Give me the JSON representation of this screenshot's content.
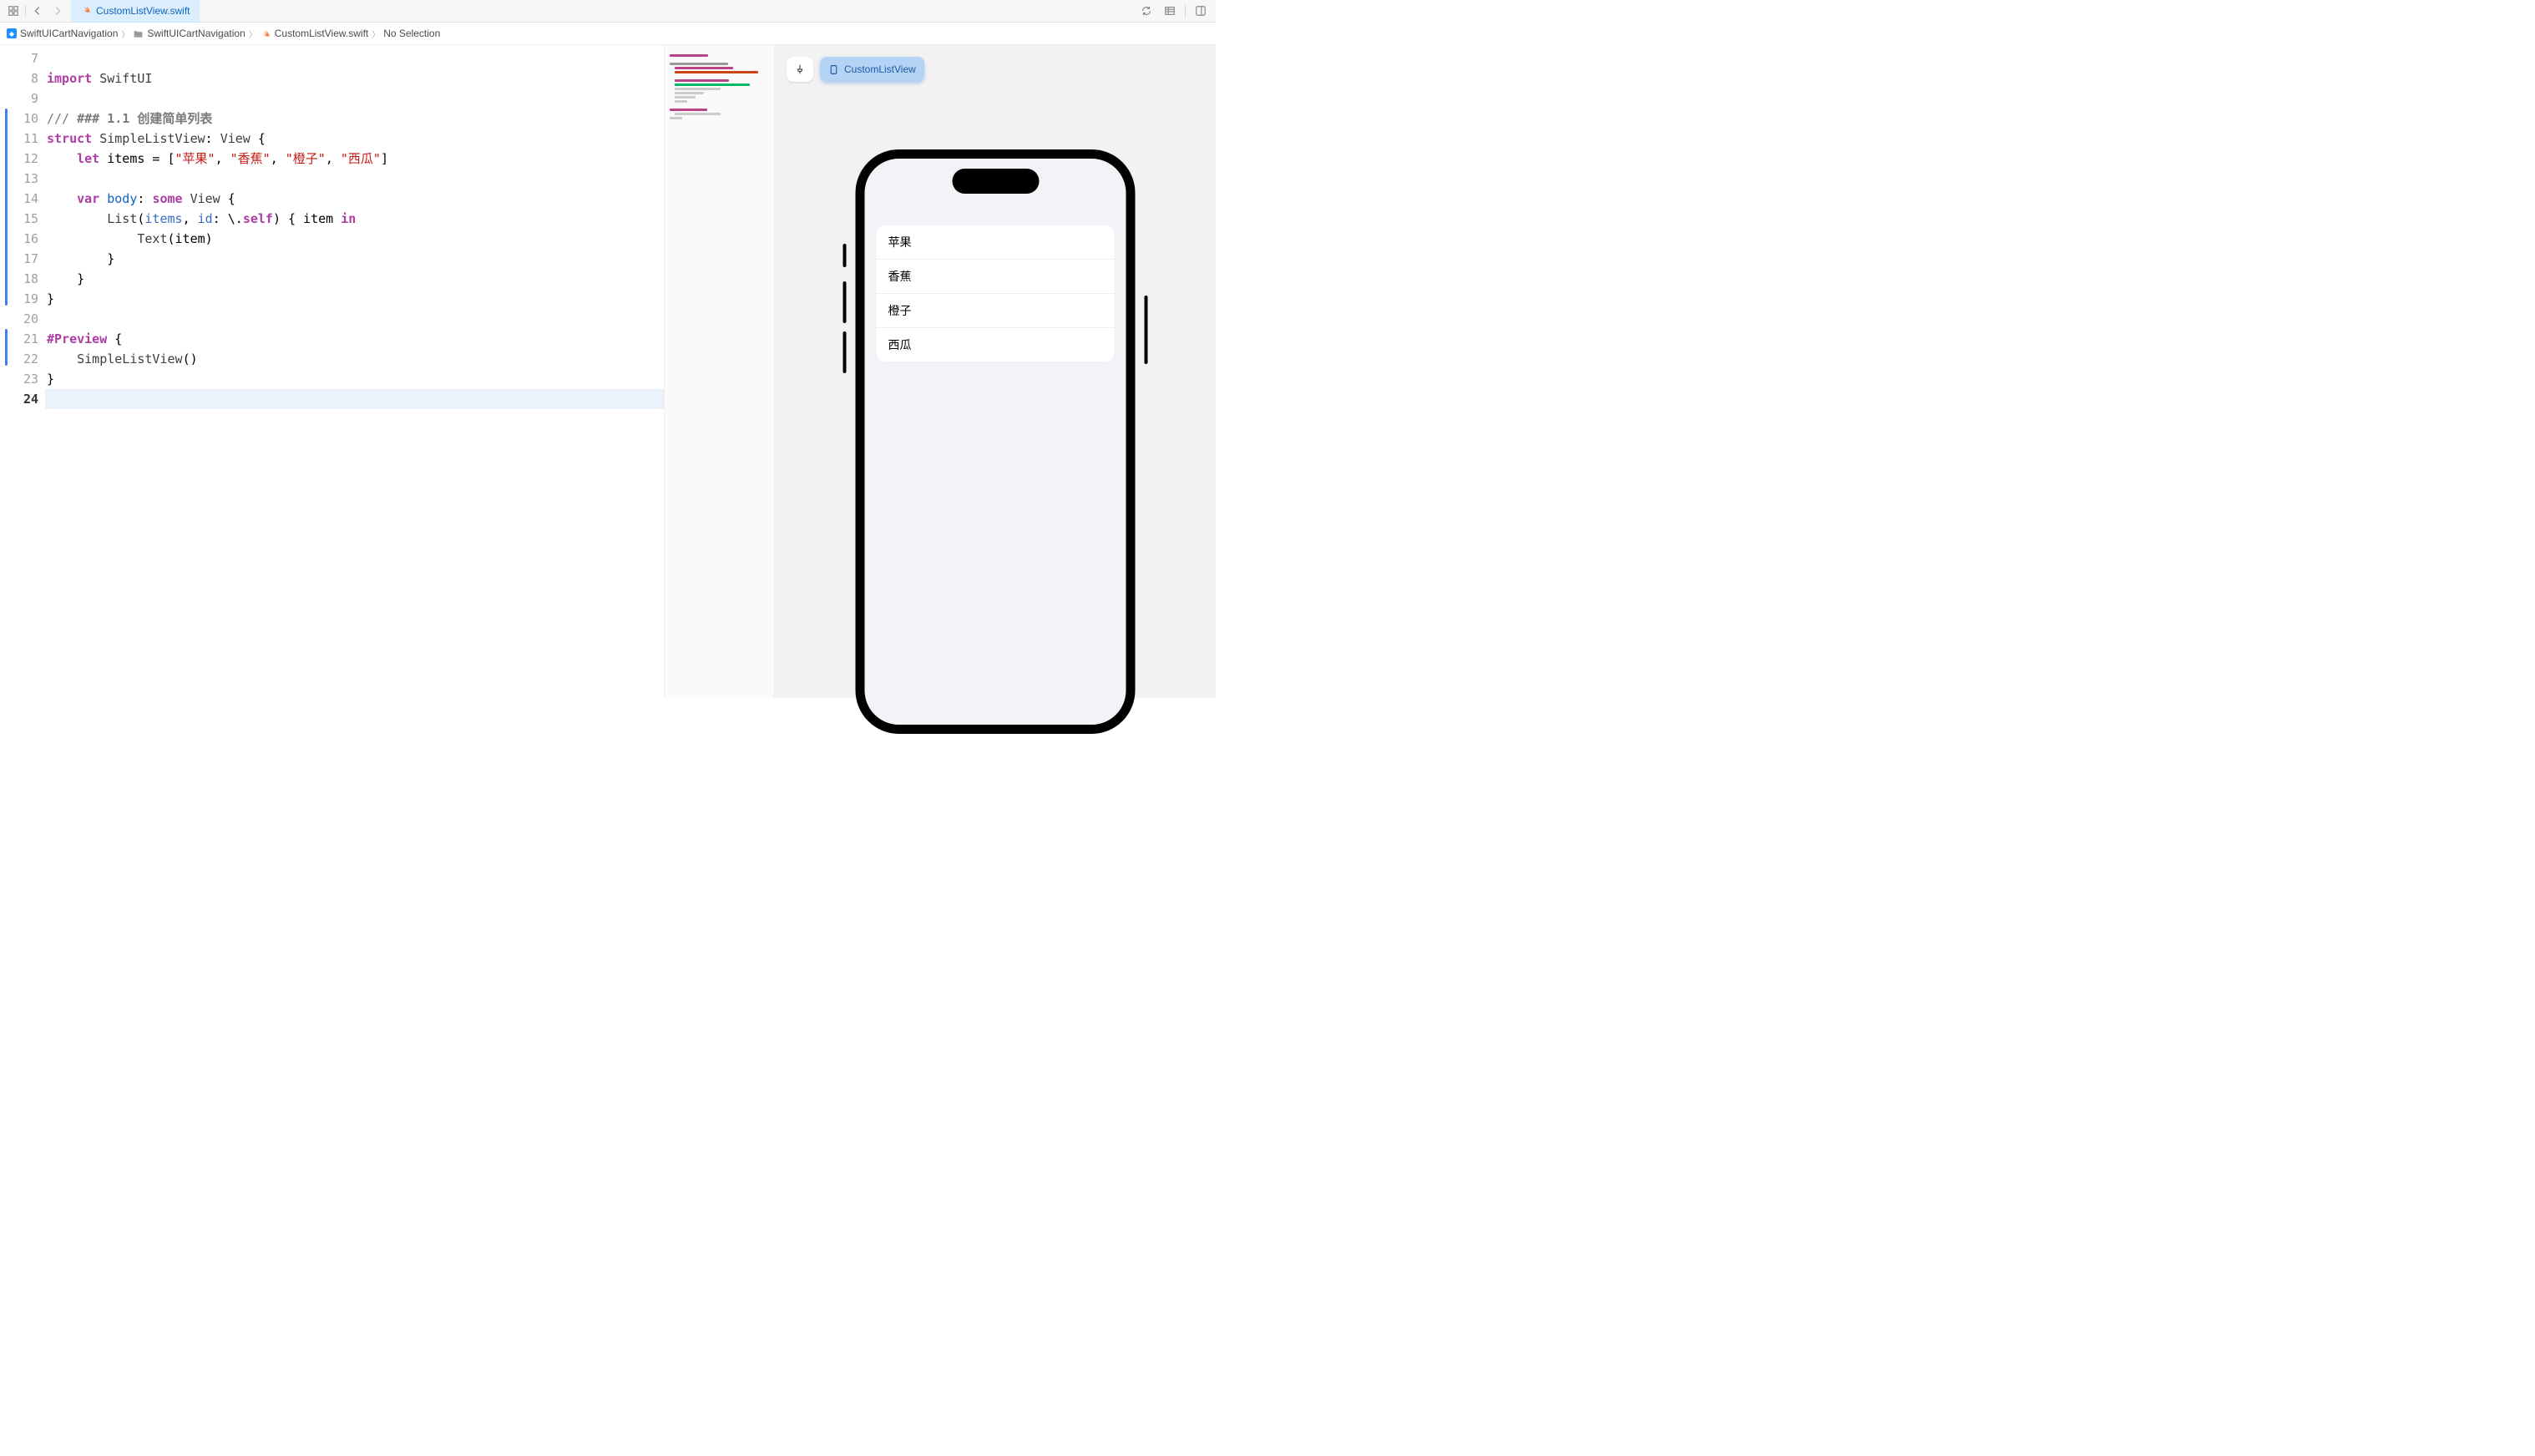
{
  "tab": {
    "label": "CustomListView.swift"
  },
  "breadcrumb": {
    "project": "SwiftUICartNavigation",
    "folder": "SwiftUICartNavigation",
    "file": "CustomListView.swift",
    "selection": "No Selection"
  },
  "gutter": {
    "start": 7,
    "end": 24,
    "active": 24,
    "change_ranges": [
      [
        10,
        19
      ],
      [
        21,
        22
      ]
    ]
  },
  "code": {
    "7": "",
    "8": [
      [
        "kw",
        "import"
      ],
      [
        "",
        " "
      ],
      [
        "type",
        "SwiftUI"
      ]
    ],
    "9": "",
    "10": [
      [
        "cmt",
        "/// "
      ],
      [
        "cmt-bold",
        "### 1.1 创建简单列表"
      ]
    ],
    "11": [
      [
        "kw",
        "struct"
      ],
      [
        "",
        " "
      ],
      [
        "type",
        "SimpleListView"
      ],
      [
        "",
        ": "
      ],
      [
        "type",
        "View"
      ],
      [
        "",
        " {"
      ]
    ],
    "12": [
      [
        "",
        "    "
      ],
      [
        "kw",
        "let"
      ],
      [
        "",
        " items = ["
      ],
      [
        "str",
        "\"苹果\""
      ],
      [
        "",
        ", "
      ],
      [
        "str",
        "\"香蕉\""
      ],
      [
        "",
        ", "
      ],
      [
        "str",
        "\"橙子\""
      ],
      [
        "",
        ", "
      ],
      [
        "str",
        "\"西瓜\""
      ],
      [
        "",
        "]"
      ]
    ],
    "13": "",
    "14": [
      [
        "",
        "    "
      ],
      [
        "kw",
        "var"
      ],
      [
        "",
        " "
      ],
      [
        "id2",
        "body"
      ],
      [
        "",
        ": "
      ],
      [
        "kw",
        "some"
      ],
      [
        "",
        " "
      ],
      [
        "type",
        "View"
      ],
      [
        "",
        " {"
      ]
    ],
    "15": [
      [
        "",
        "        "
      ],
      [
        "type",
        "List"
      ],
      [
        "",
        "("
      ],
      [
        "param",
        "items"
      ],
      [
        "",
        ", "
      ],
      [
        "param",
        "id"
      ],
      [
        "",
        ": \\."
      ],
      [
        "selfk",
        "self"
      ],
      [
        "",
        ") { item "
      ],
      [
        "ink",
        "in"
      ]
    ],
    "16": [
      [
        "",
        "            "
      ],
      [
        "type",
        "Text"
      ],
      [
        "",
        "(item)"
      ]
    ],
    "17": [
      [
        "",
        "        }"
      ]
    ],
    "18": [
      [
        "",
        "    }"
      ]
    ],
    "19": [
      [
        "",
        "}"
      ]
    ],
    "20": "",
    "21": [
      [
        "kw",
        "#Preview"
      ],
      [
        "",
        " {"
      ]
    ],
    "22": [
      [
        "",
        "    "
      ],
      [
        "type",
        "SimpleListView"
      ],
      [
        "",
        "()"
      ]
    ],
    "23": [
      [
        "",
        "}"
      ]
    ],
    "24": ""
  },
  "preview": {
    "pin_tooltip": "Pin Preview",
    "view_name": "CustomListView",
    "list_items": [
      "苹果",
      "香蕉",
      "橙子",
      "西瓜"
    ]
  }
}
